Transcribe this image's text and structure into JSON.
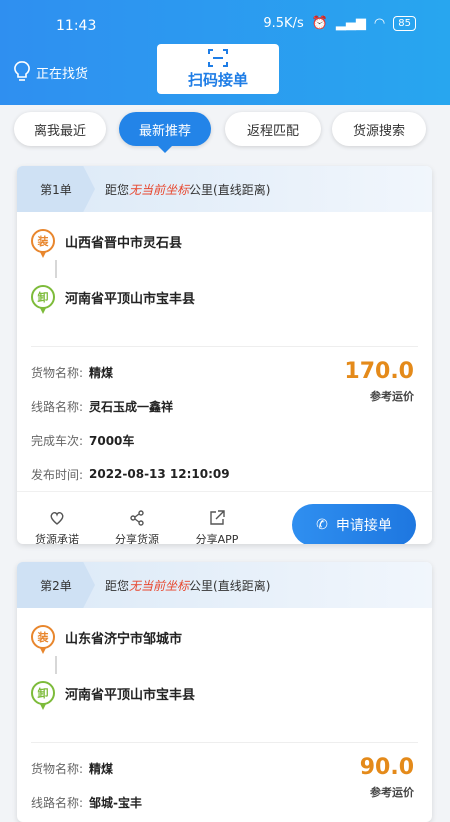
{
  "status": {
    "time": "11:43",
    "net_speed": "9.5K/s",
    "battery": "85"
  },
  "header": {
    "finding_label": "正在找货",
    "scan_label": "扫码接单"
  },
  "tabs": [
    {
      "label": "离我最近"
    },
    {
      "label": "最新推荐"
    },
    {
      "label": "返程匹配"
    },
    {
      "label": "货源搜索"
    }
  ],
  "active_tab": "最新推荐",
  "cards": [
    {
      "order_no": "第1单",
      "distance_prefix": "距您",
      "distance_highlight": "无当前坐标",
      "distance_suffix": "公里(直线距离)",
      "load_badge": "装",
      "load_place": "山西省晋中市灵石县",
      "unload_badge": "卸",
      "unload_place": "河南省平顶山市宝丰县",
      "rows": [
        {
          "k": "货物名称:",
          "v": "精煤"
        },
        {
          "k": "线路名称:",
          "v": "灵石玉成一鑫祥"
        },
        {
          "k": "完成车次:",
          "v": "7000车"
        },
        {
          "k": "发布时间:",
          "v": "2022-08-13 12:10:09"
        }
      ],
      "price": "170.0",
      "price_caption": "参考运价",
      "actions": [
        "货源承诺",
        "分享货源",
        "分享APP"
      ],
      "apply_label": "申请接单"
    },
    {
      "order_no": "第2单",
      "distance_prefix": "距您",
      "distance_highlight": "无当前坐标",
      "distance_suffix": "公里(直线距离)",
      "load_badge": "装",
      "load_place": "山东省济宁市邹城市",
      "unload_badge": "卸",
      "unload_place": "河南省平顶山市宝丰县",
      "rows": [
        {
          "k": "货物名称:",
          "v": "精煤"
        },
        {
          "k": "线路名称:",
          "v": "邹城-宝丰"
        }
      ],
      "price": "90.0",
      "price_caption": "参考运价"
    }
  ]
}
